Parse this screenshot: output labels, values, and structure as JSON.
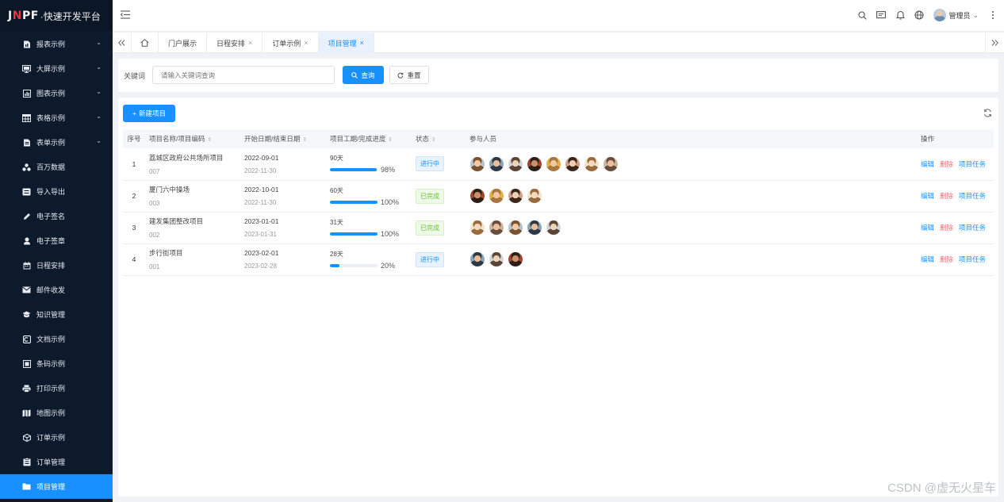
{
  "logo": {
    "brand_1": "J",
    "brand_2": "N",
    "brand_3": "PF",
    "subtitle": "·快速开发平台"
  },
  "sidebar": {
    "items": [
      {
        "label": "报表示例",
        "icon": "report-icon",
        "arrow": "⌄"
      },
      {
        "label": "大屏示例",
        "icon": "monitor-icon",
        "arrow": "⌄"
      },
      {
        "label": "图表示例",
        "icon": "chart-icon",
        "arrow": "⌄"
      },
      {
        "label": "表格示例",
        "icon": "table-icon",
        "arrow": "⌄"
      },
      {
        "label": "表单示例",
        "icon": "form-icon",
        "arrow": "⌄"
      },
      {
        "label": "百万数据",
        "icon": "data-icon"
      },
      {
        "label": "导入导出",
        "icon": "import-export-icon"
      },
      {
        "label": "电子签名",
        "icon": "pen-icon"
      },
      {
        "label": "电子签章",
        "icon": "stamp-icon"
      },
      {
        "label": "日程安排",
        "icon": "calendar-icon"
      },
      {
        "label": "邮件收发",
        "icon": "mail-icon"
      },
      {
        "label": "知识管理",
        "icon": "book-icon"
      },
      {
        "label": "文档示例",
        "icon": "document-icon"
      },
      {
        "label": "条码示例",
        "icon": "barcode-icon"
      },
      {
        "label": "打印示例",
        "icon": "printer-icon"
      },
      {
        "label": "地图示例",
        "icon": "map-icon"
      },
      {
        "label": "订单示例",
        "icon": "box-icon"
      },
      {
        "label": "订单管理",
        "icon": "clipboard-icon"
      },
      {
        "label": "项目管理",
        "icon": "folder-icon",
        "active": true
      }
    ]
  },
  "header": {
    "user_name": "管理员",
    "user_arrow": "⌄"
  },
  "tabs": [
    {
      "label": "门户展示",
      "closable": false
    },
    {
      "label": "日程安排",
      "closable": true
    },
    {
      "label": "订单示例",
      "closable": true
    },
    {
      "label": "项目管理",
      "closable": true,
      "active": true
    }
  ],
  "tab_close": "×",
  "search": {
    "label": "关键词",
    "placeholder": "请输入关键词查询",
    "query_label": "查询",
    "reset_label": "重置"
  },
  "toolbar": {
    "new_label": "新建项目",
    "new_plus": "+"
  },
  "table": {
    "headers": [
      "序号",
      "项目名称/项目编码",
      "开始日期/结束日期",
      "项目工期/完成进度",
      "状态",
      "参与人员",
      "操作"
    ],
    "sort_mark": "⇕",
    "rows": [
      {
        "idx": "1",
        "name": "荔城区政府公共场所项目",
        "code": "007",
        "start": "2022-09-01",
        "end": "2022-11-30",
        "days": "90天",
        "pct": "98%",
        "progress": 0.98,
        "status": "进行中",
        "status_type": "ing",
        "people": 8
      },
      {
        "idx": "2",
        "name": "厦门六中操场",
        "code": "003",
        "start": "2022-10-01",
        "end": "2022-11-30",
        "days": "60天",
        "pct": "100%",
        "progress": 1.0,
        "status": "已完成",
        "status_type": "done",
        "people": 4
      },
      {
        "idx": "3",
        "name": "建发集团整改项目",
        "code": "002",
        "start": "2023-01-01",
        "end": "2023-01-31",
        "days": "31天",
        "pct": "100%",
        "progress": 1.0,
        "status": "已完成",
        "status_type": "done",
        "people": 5
      },
      {
        "idx": "4",
        "name": "步行街项目",
        "code": "001",
        "start": "2023-02-01",
        "end": "2023-02-28",
        "days": "28天",
        "pct": "20%",
        "progress": 0.2,
        "status": "进行中",
        "status_type": "ing",
        "people": 3
      }
    ],
    "ops": {
      "edit": "编辑",
      "delete": "删除",
      "task": "项目任务"
    }
  },
  "watermark": "CSDN @虚无火星车",
  "colors": {
    "primary": "#1890ff",
    "sidebar_bg": "#0c1a2c",
    "danger": "#f56c6c",
    "success": "#67c23a"
  }
}
